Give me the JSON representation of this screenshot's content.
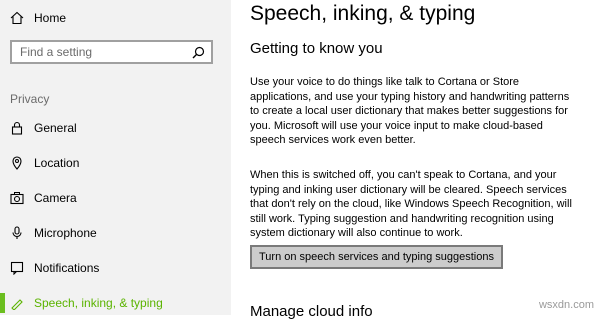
{
  "sidebar": {
    "home_label": "Home",
    "search_placeholder": "Find a setting",
    "section_label": "Privacy",
    "items": [
      {
        "label": "General",
        "icon": "lock-icon"
      },
      {
        "label": "Location",
        "icon": "location-pin-icon"
      },
      {
        "label": "Camera",
        "icon": "camera-icon"
      },
      {
        "label": "Microphone",
        "icon": "microphone-icon"
      },
      {
        "label": "Notifications",
        "icon": "notifications-icon"
      },
      {
        "label": "Speech, inking, & typing",
        "icon": "speech-inking-icon",
        "selected": true
      }
    ]
  },
  "main": {
    "title": "Speech, inking, & typing",
    "subtitle": "Getting to know you",
    "paragraph1": "Use your voice to do things like talk to Cortana or Store\napplications, and use your typing history and handwriting patterns\nto create a local user dictionary that makes better suggestions for\nyou. Microsoft will use your voice input to make cloud-based\nspeech services work even better.",
    "paragraph2": "When this is switched off, you can't speak to Cortana, and your\ntyping and inking user dictionary will be cleared. Speech services\nthat don't rely on the cloud, like Windows Speech Recognition, will\nstill work. Typing suggestion and handwriting recognition using\nsystem dictionary will also continue to work.",
    "button_label": "Turn on speech services and typing suggestions",
    "next_heading": "Manage cloud info"
  },
  "watermark": "wsxdn.com",
  "colors": {
    "accent": "#6bbe1f",
    "sidebar_bg": "#f2f2f2",
    "button_bg": "#cccccc"
  }
}
